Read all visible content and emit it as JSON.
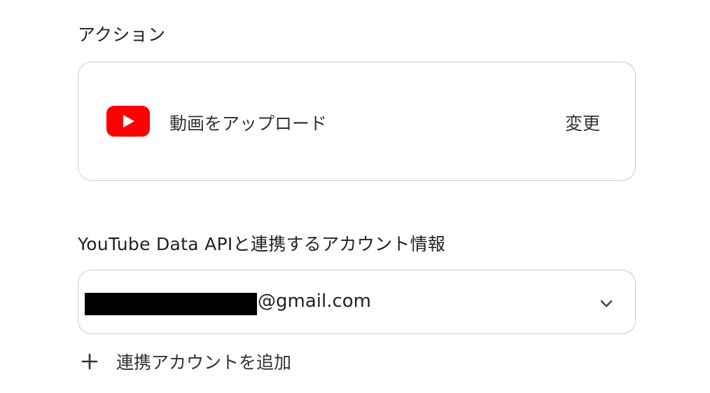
{
  "action_section": {
    "label": "アクション",
    "card": {
      "icon": "youtube-icon",
      "action_name": "動画をアップロード",
      "change_label": "変更"
    }
  },
  "account_section": {
    "label": "YouTube Data APIと連携するアカウント情報",
    "selected_account": {
      "email_suffix": "@gmail.com"
    },
    "add_account_label": "連携アカウントを追加"
  },
  "colors": {
    "youtube_red": "#FF0000",
    "border": "#C8CCD1",
    "text": "#222222"
  }
}
